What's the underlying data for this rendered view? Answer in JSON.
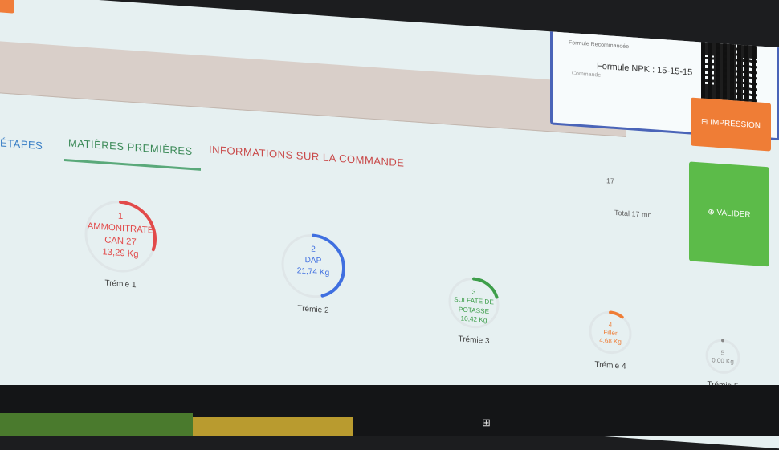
{
  "tabs": [
    {
      "label": "ÉTAPES"
    },
    {
      "label": "MATIÈRES PREMIÈRES"
    },
    {
      "label": "INFORMATIONS SUR LA COMMANDE"
    }
  ],
  "progress": {
    "end_value": "17",
    "total_label": "Total 17 mn"
  },
  "card": {
    "small_top": "Formule Recommandée",
    "title": "Formule NPK : 15-15-15",
    "small_left": "Commande"
  },
  "buttons": {
    "impression": "IMPRESSION",
    "valider": "VALIDER"
  },
  "tremies": [
    {
      "index": "1",
      "name": "AMMONITRATE",
      "line2": "CAN 27",
      "weight": "13,29 Kg",
      "label": "Trémie 1",
      "color": "#e24a4a",
      "progress": 0.3
    },
    {
      "index": "2",
      "name": "DAP",
      "line2": "",
      "weight": "21,74 Kg",
      "label": "Trémie 2",
      "color": "#3f6fe0",
      "progress": 0.45
    },
    {
      "index": "3",
      "name": "SULFATE DE",
      "line2": "POTASSE",
      "weight": "10,42 Kg",
      "label": "Trémie 3",
      "color": "#3d9e4a",
      "progress": 0.2
    },
    {
      "index": "4",
      "name": "Filler",
      "line2": "",
      "weight": "4,68 Kg",
      "label": "Trémie 4",
      "color": "#ef7d36",
      "progress": 0.1
    },
    {
      "index": "5",
      "name": "",
      "line2": "",
      "weight": "0,00 Kg",
      "label": "Trémie 5",
      "color": "#888888",
      "progress": 0
    }
  ]
}
